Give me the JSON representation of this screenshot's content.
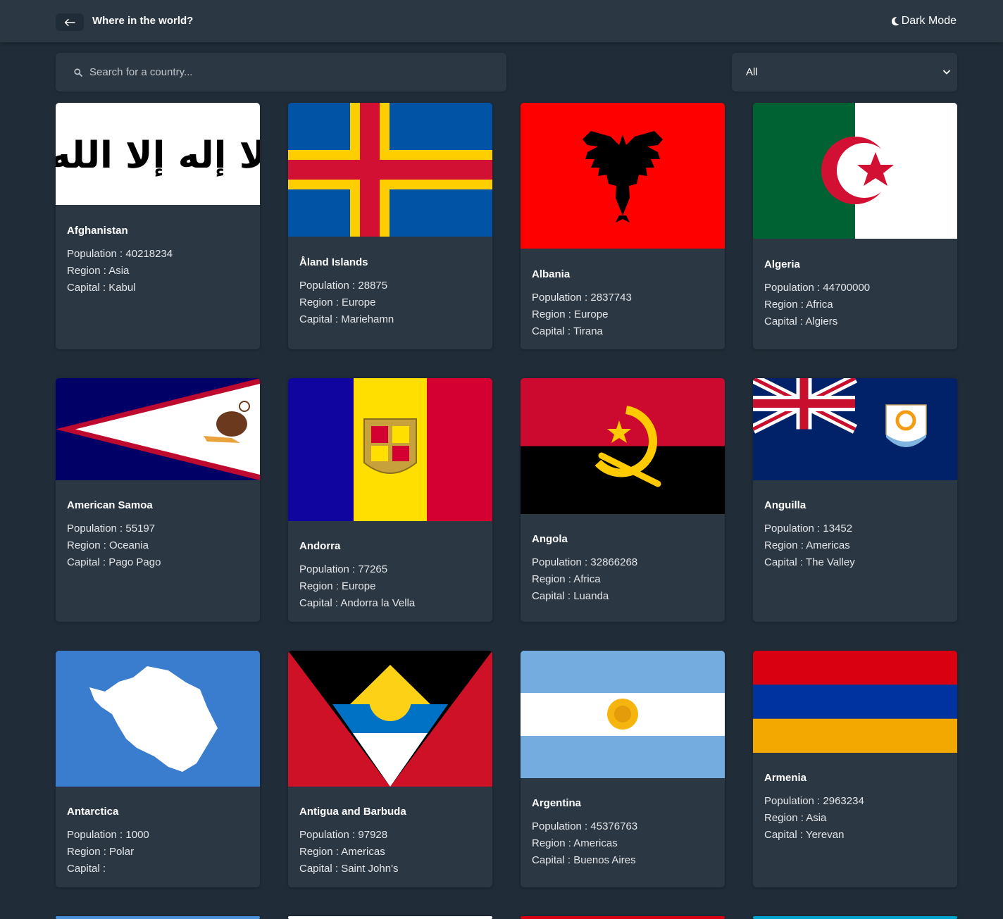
{
  "header": {
    "title": "Where in the world?",
    "dark_mode_label": "Dark Mode"
  },
  "search": {
    "placeholder": "Search for a country..."
  },
  "filter": {
    "selected": "All"
  },
  "labels": {
    "population": "Population : ",
    "region": "Region : ",
    "capital": "Capital : "
  },
  "countries": [
    {
      "name": "Afghanistan",
      "population": "40218234",
      "region": "Asia",
      "capital": "Kabul",
      "flag": "afghanistan-flag"
    },
    {
      "name": "Åland Islands",
      "population": "28875",
      "region": "Europe",
      "capital": "Mariehamn",
      "flag": "aland-flag"
    },
    {
      "name": "Albania",
      "population": "2837743",
      "region": "Europe",
      "capital": "Tirana",
      "flag": "albania-flag"
    },
    {
      "name": "Algeria",
      "population": "44700000",
      "region": "Africa",
      "capital": "Algiers",
      "flag": "algeria-flag"
    },
    {
      "name": "American Samoa",
      "population": "55197",
      "region": "Oceania",
      "capital": "Pago Pago",
      "flag": "american-samoa-flag"
    },
    {
      "name": "Andorra",
      "population": "77265",
      "region": "Europe",
      "capital": "Andorra la Vella",
      "flag": "andorra-flag"
    },
    {
      "name": "Angola",
      "population": "32866268",
      "region": "Africa",
      "capital": "Luanda",
      "flag": "angola-flag"
    },
    {
      "name": "Anguilla",
      "population": "13452",
      "region": "Americas",
      "capital": "The Valley",
      "flag": "anguilla-flag"
    },
    {
      "name": "Antarctica",
      "population": "1000",
      "region": "Polar",
      "capital": "",
      "flag": "antarctica-flag"
    },
    {
      "name": "Antigua and Barbuda",
      "population": "97928",
      "region": "Americas",
      "capital": "Saint John's",
      "flag": "antigua-flag"
    },
    {
      "name": "Argentina",
      "population": "45376763",
      "region": "Americas",
      "capital": "Buenos Aires",
      "flag": "argentina-flag"
    },
    {
      "name": "Armenia",
      "population": "2963234",
      "region": "Asia",
      "capital": "Yerevan",
      "flag": "armenia-flag"
    }
  ]
}
